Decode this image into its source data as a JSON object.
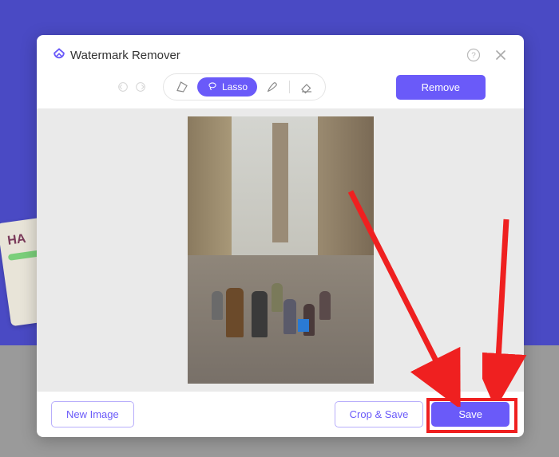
{
  "app": {
    "title": "Watermark Remover"
  },
  "toolbar": {
    "lasso_label": "Lasso",
    "remove_label": "Remove"
  },
  "footer": {
    "new_image_label": "New Image",
    "crop_save_label": "Crop & Save",
    "save_label": "Save"
  },
  "colors": {
    "accent": "#6a5af9",
    "annotation": "#ef2020"
  }
}
